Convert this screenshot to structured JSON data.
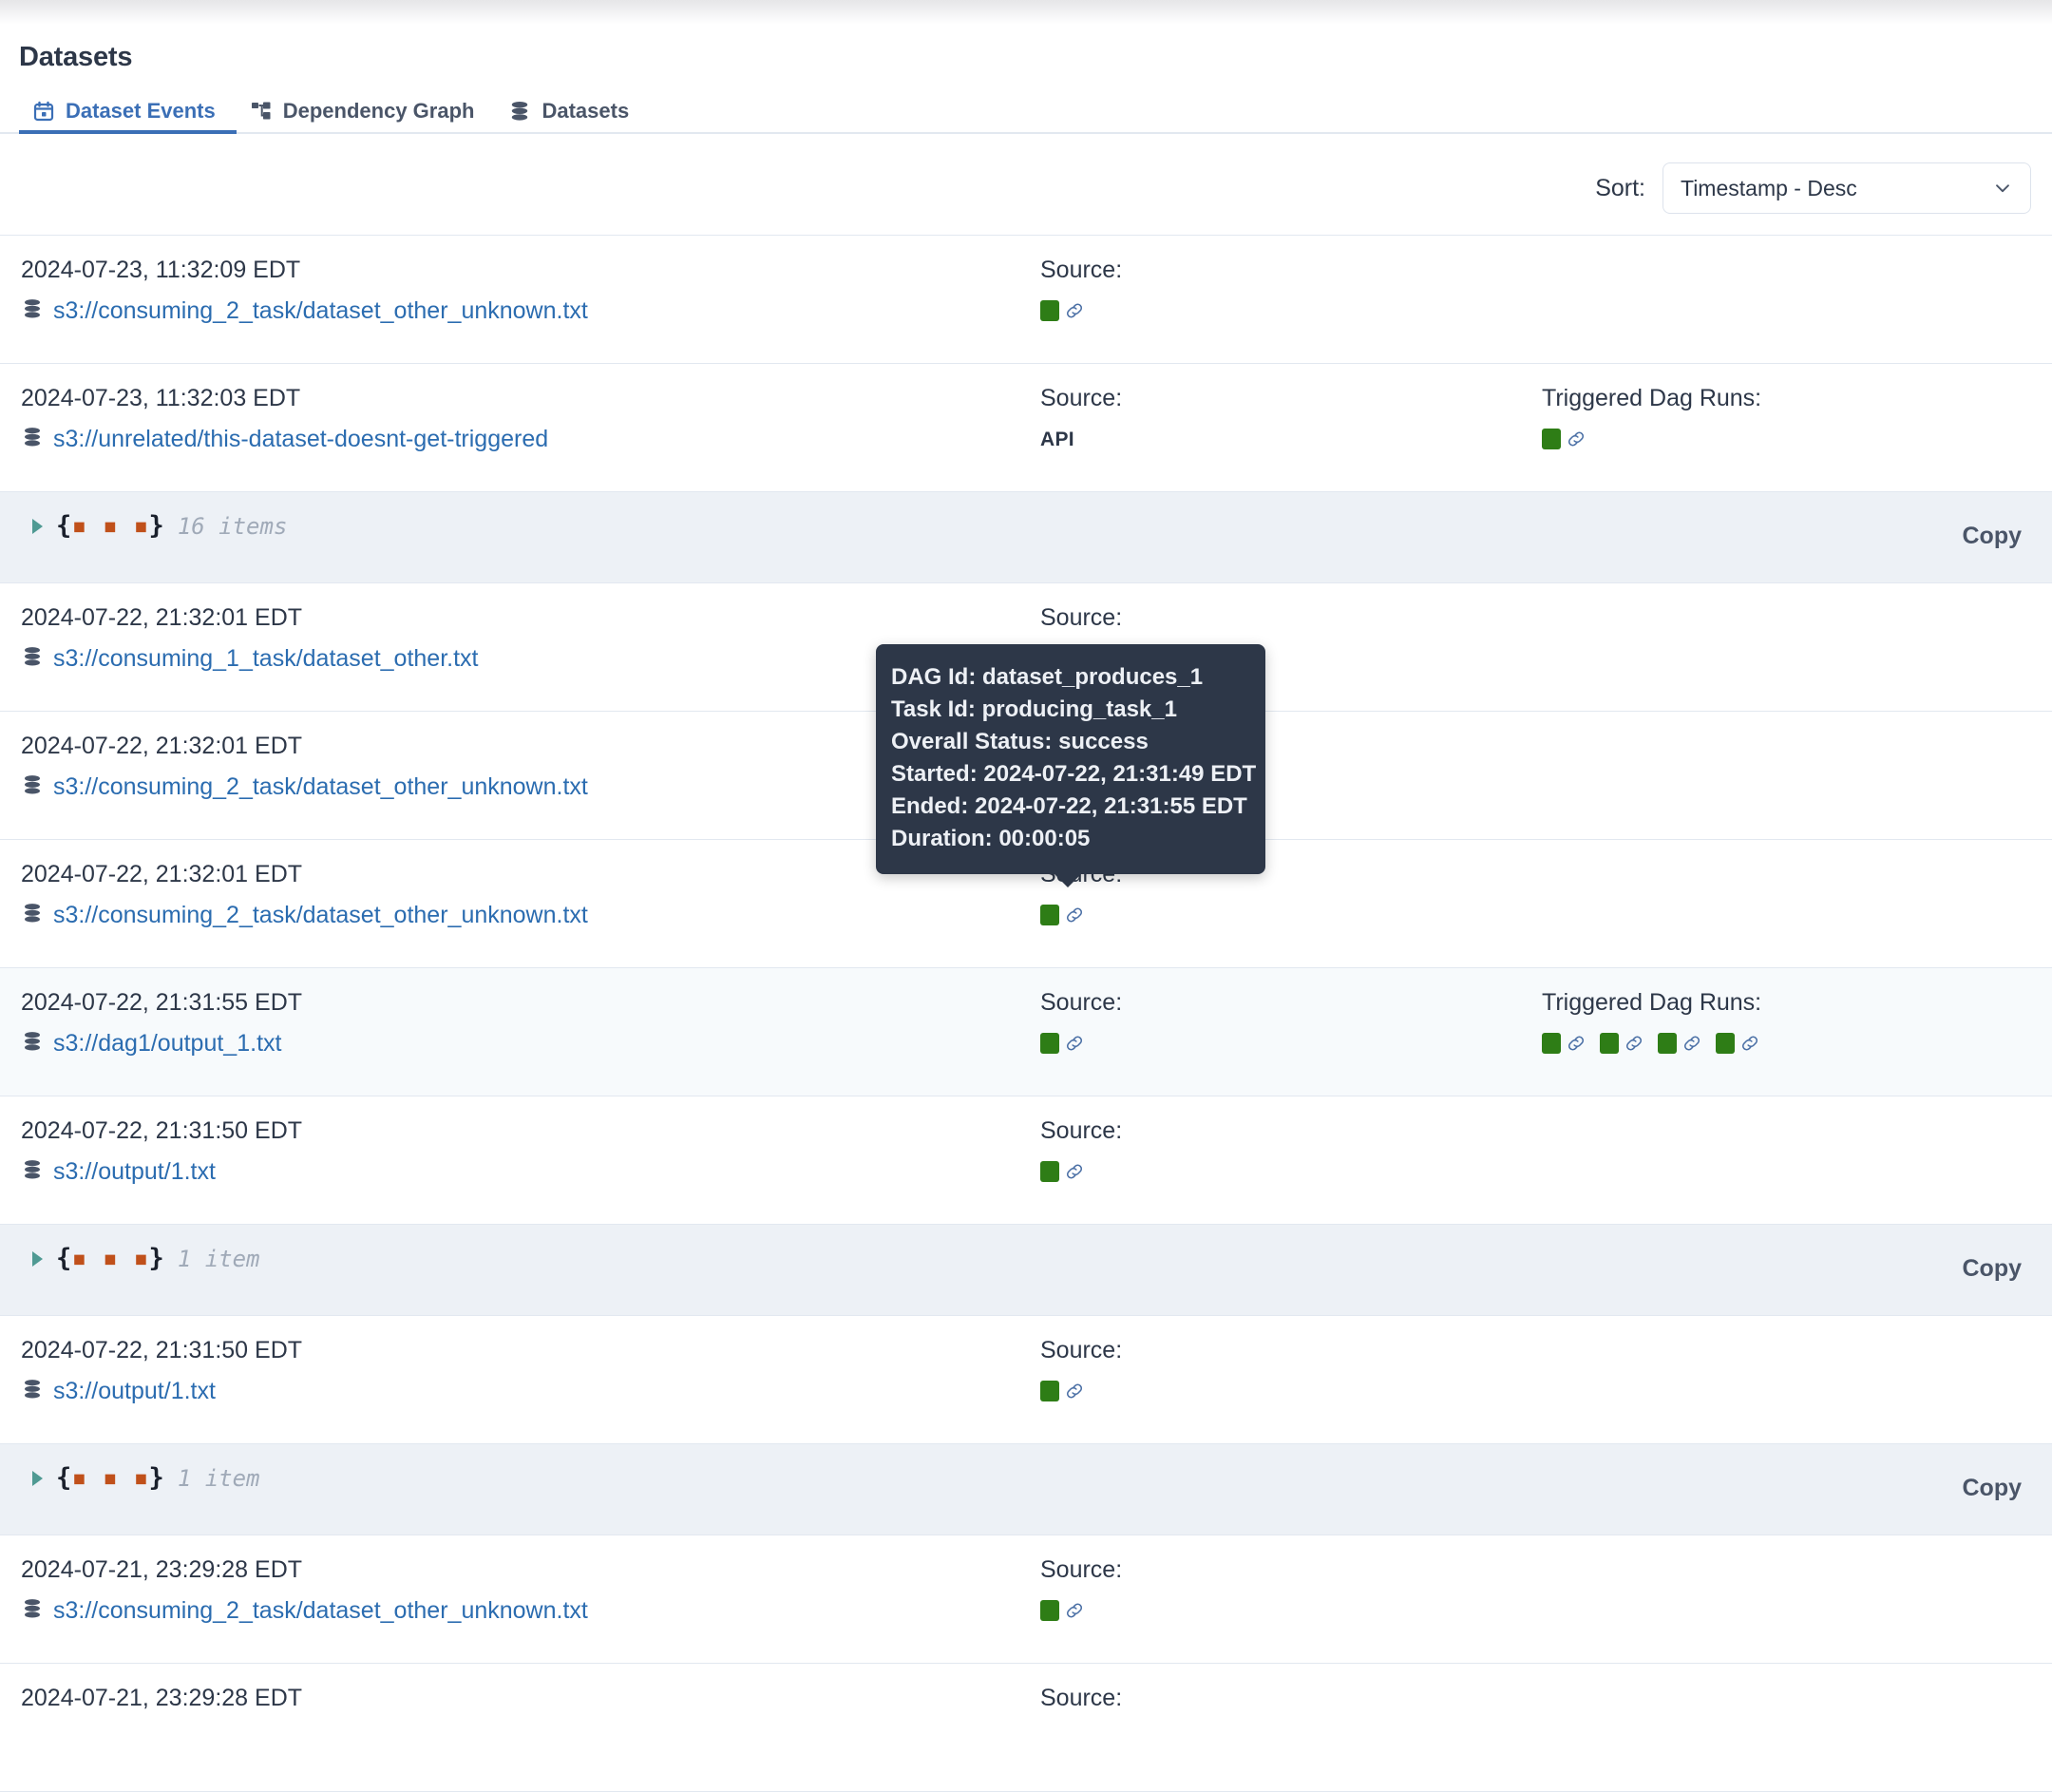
{
  "header": {
    "title": "Datasets"
  },
  "tabs": [
    {
      "label": "Dataset Events",
      "icon": "calendar-icon",
      "active": true
    },
    {
      "label": "Dependency Graph",
      "icon": "graph-icon",
      "active": false
    },
    {
      "label": "Datasets",
      "icon": "database-icon",
      "active": false
    }
  ],
  "toolbar": {
    "sort_label": "Sort:",
    "sort_value": "Timestamp - Desc",
    "sort_options": [
      "Timestamp - Desc"
    ],
    "chevron_icon": "chevron-down-icon"
  },
  "columns": {
    "source": "Source:",
    "triggered": "Triggered Dag Runs:"
  },
  "copy_label": "Copy",
  "colors": {
    "accent": "#3b6fb6",
    "link": "#2b6cb0",
    "success": "#2e7d16",
    "tooltip_bg": "#2d3748",
    "json_row_bg": "#edf1f6",
    "row_highlight": "#f7fafc"
  },
  "rows": [
    {
      "kind": "event",
      "timestamp": "2024-07-23, 11:32:09 EDT",
      "uri": "s3://consuming_2_task/dataset_other_unknown.txt",
      "source_label": "Source:",
      "source_type": "badges",
      "source_badges": 1,
      "triggered_label": "",
      "triggered_badges": 0,
      "highlight": false
    },
    {
      "kind": "event",
      "timestamp": "2024-07-23, 11:32:03 EDT",
      "uri": "s3://unrelated/this-dataset-doesnt-get-triggered",
      "source_label": "Source:",
      "source_type": "api",
      "source_text": "API",
      "source_badges": 0,
      "triggered_label": "Triggered Dag Runs:",
      "triggered_badges": 1,
      "highlight": false
    },
    {
      "kind": "json",
      "count": "16 items",
      "brace_open": "{",
      "brace_close": "}",
      "copy": "Copy"
    },
    {
      "kind": "event",
      "timestamp": "2024-07-22, 21:32:01 EDT",
      "uri": "s3://consuming_1_task/dataset_other.txt",
      "source_label": "Source:",
      "source_type": "badges",
      "source_badges": 1,
      "triggered_label": "",
      "triggered_badges": 0,
      "highlight": false
    },
    {
      "kind": "event",
      "timestamp": "2024-07-22, 21:32:01 EDT",
      "uri": "s3://consuming_2_task/dataset_other_unknown.txt",
      "source_label": "Source:",
      "source_type": "badges",
      "source_badges": 1,
      "triggered_label": "",
      "triggered_badges": 0,
      "highlight": false
    },
    {
      "kind": "event",
      "timestamp": "2024-07-22, 21:32:01 EDT",
      "uri": "s3://consuming_2_task/dataset_other_unknown.txt",
      "source_label": "Source:",
      "source_type": "badges",
      "source_badges": 1,
      "triggered_label": "",
      "triggered_badges": 0,
      "highlight": false
    },
    {
      "kind": "event",
      "timestamp": "2024-07-22, 21:31:55 EDT",
      "uri": "s3://dag1/output_1.txt",
      "source_label": "Source:",
      "source_type": "badges",
      "source_badges": 1,
      "triggered_label": "Triggered Dag Runs:",
      "triggered_badges": 4,
      "highlight": true
    },
    {
      "kind": "event",
      "timestamp": "2024-07-22, 21:31:50 EDT",
      "uri": "s3://output/1.txt",
      "source_label": "Source:",
      "source_type": "badges",
      "source_badges": 1,
      "triggered_label": "",
      "triggered_badges": 0,
      "highlight": false
    },
    {
      "kind": "json",
      "count": "1 item",
      "brace_open": "{",
      "brace_close": "}",
      "copy": "Copy"
    },
    {
      "kind": "event",
      "timestamp": "2024-07-22, 21:31:50 EDT",
      "uri": "s3://output/1.txt",
      "source_label": "Source:",
      "source_type": "badges",
      "source_badges": 1,
      "triggered_label": "",
      "triggered_badges": 0,
      "highlight": false
    },
    {
      "kind": "json",
      "count": "1 item",
      "brace_open": "{",
      "brace_close": "}",
      "copy": "Copy"
    },
    {
      "kind": "event",
      "timestamp": "2024-07-21, 23:29:28 EDT",
      "uri": "s3://consuming_2_task/dataset_other_unknown.txt",
      "source_label": "Source:",
      "source_type": "badges",
      "source_badges": 1,
      "triggered_label": "",
      "triggered_badges": 0,
      "highlight": false
    },
    {
      "kind": "event",
      "timestamp": "2024-07-21, 23:29:28 EDT",
      "uri": "",
      "source_label": "Source:",
      "source_type": "badges",
      "source_badges": 0,
      "triggered_label": "",
      "triggered_badges": 0,
      "highlight": false
    }
  ],
  "tooltip": {
    "lines": [
      "DAG Id: dataset_produces_1",
      "Task Id: producing_task_1",
      "Overall Status: success",
      "Started: 2024-07-22, 21:31:49 EDT",
      "Ended: 2024-07-22, 21:31:55 EDT",
      "Duration: 00:00:05"
    ]
  }
}
